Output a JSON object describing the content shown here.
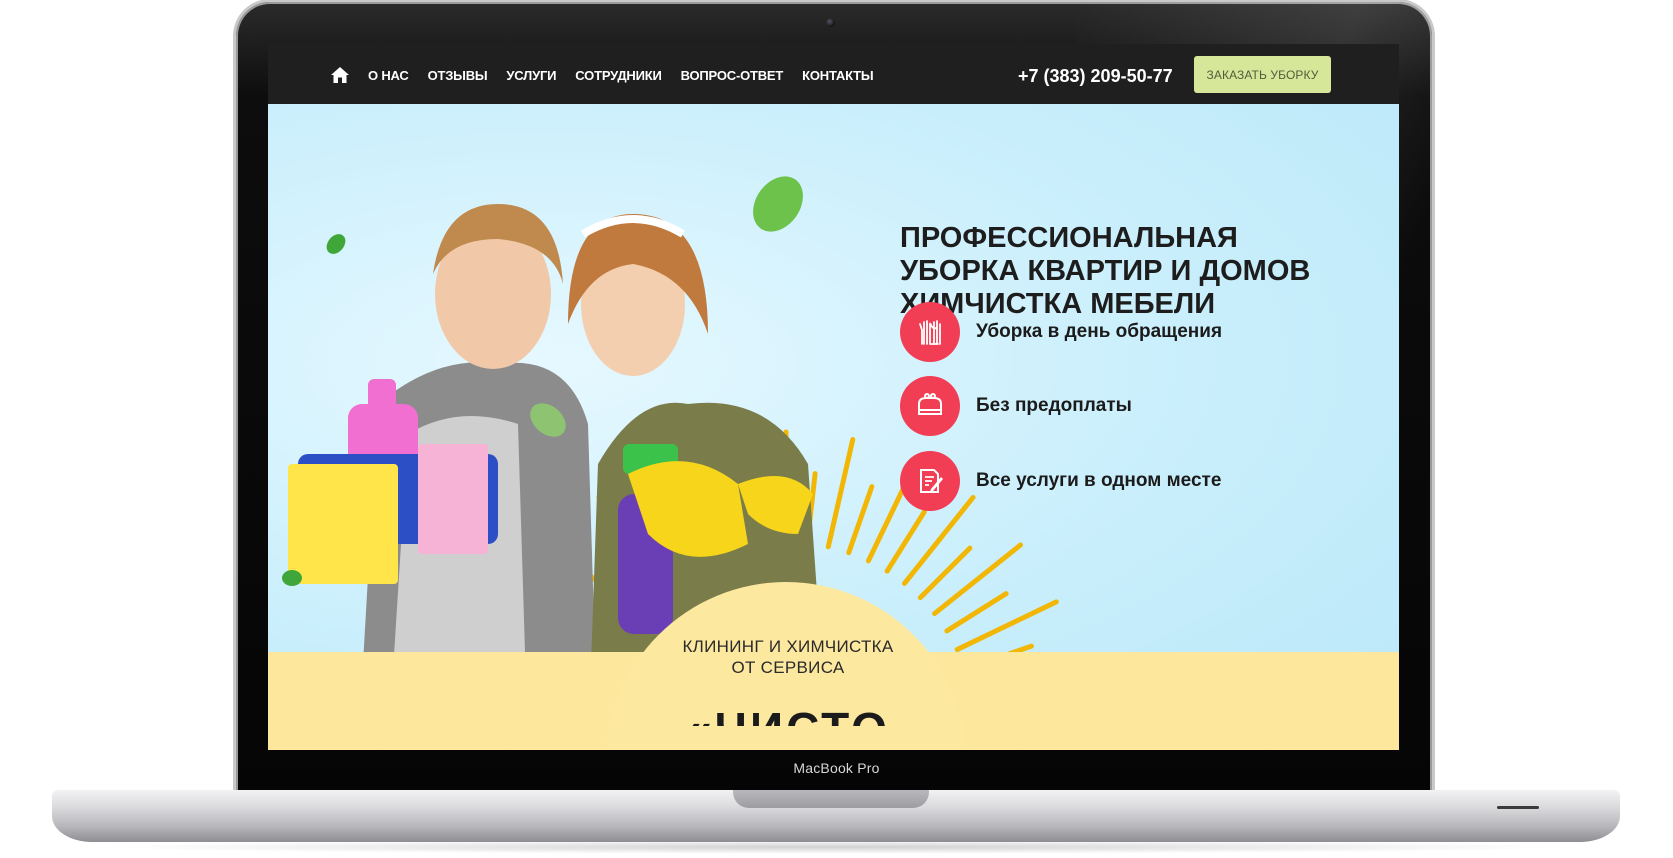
{
  "device": {
    "label": "MacBook Pro"
  },
  "nav": {
    "home_icon": "home-icon",
    "items": [
      "О НАС",
      "ОТЗЫВЫ",
      "УСЛУГИ",
      "СОТРУДНИКИ",
      "ВОПРОС-ОТВЕТ",
      "КОНТАКТЫ"
    ],
    "phone": "+7 (383) 209-50-77",
    "order_button": "ЗАКАЗАТЬ УБОРКУ"
  },
  "hero": {
    "headline": [
      "ПРОФЕССИОНАЛЬНАЯ",
      "УБОРКА КВАРТИР И ДОМОВ",
      "ХИМЧИСТКА МЕБЕЛИ"
    ],
    "features": [
      {
        "icon": "gloves-icon",
        "text": "Уборка в день обращения"
      },
      {
        "icon": "wallet-icon",
        "text": "Без предоплаты"
      },
      {
        "icon": "document-edit-icon",
        "text": "Все услуги в одном месте"
      }
    ],
    "caption_line1": "КЛИНИНГ И ХИМЧИСТКА",
    "caption_line2": "ОТ СЕРВИСА",
    "brand_partial": "«ЧИСТО ПИТИ»"
  },
  "colors": {
    "nav_bg": "#1f1f1f",
    "order_button_bg": "#d6e79a",
    "feature_icon_bg": "#f23e55",
    "hero_bg": "#cdeefb",
    "band_bg": "#fde79d",
    "sun_rays": "#f2b705"
  }
}
